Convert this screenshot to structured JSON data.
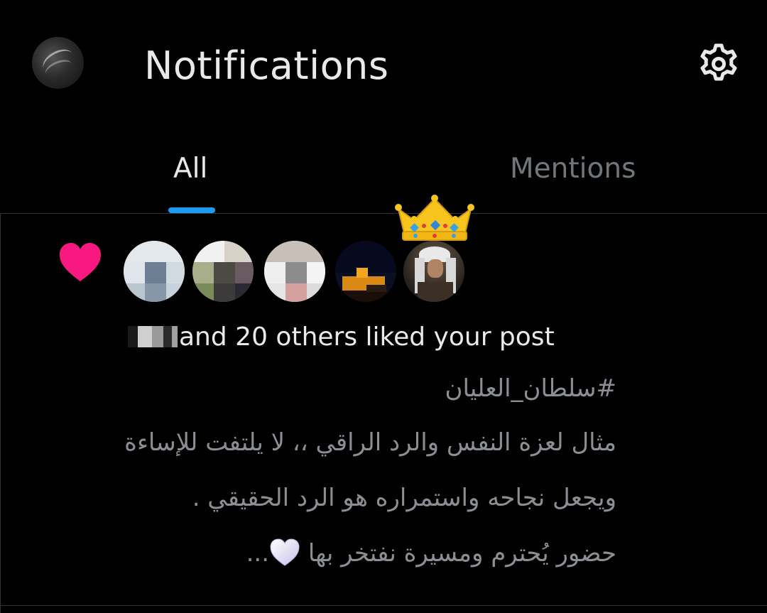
{
  "header": {
    "title": "Notifications",
    "settings_icon": "gear-icon",
    "profile_icon": "avatar"
  },
  "tabs": [
    {
      "label": "All",
      "active": true
    },
    {
      "label": "Mentions",
      "active": false
    }
  ],
  "colors": {
    "accent": "#1d9bf0",
    "heart": "#f91880",
    "text_primary": "#e7e9ea",
    "text_secondary": "#71767b",
    "background": "#000000"
  },
  "notification": {
    "type_icon": "heart-icon",
    "badge_icon": "crown-icon",
    "liker_count_shown": 5,
    "summary": "and 20 others liked your post",
    "post_lines": [
      "#سلطان_العليان",
      "مثال لعزة النفس والرد الراقي ،، لا يلتفت للإساءة",
      "ويجعل نجاحه واستمراره هو الرد الحقيقي .",
      "حضور يُحترم ومسيرة نفتخر بها"
    ],
    "post_trailing_ellipsis": "...",
    "post_emoji_icon": "white-heart-icon"
  }
}
